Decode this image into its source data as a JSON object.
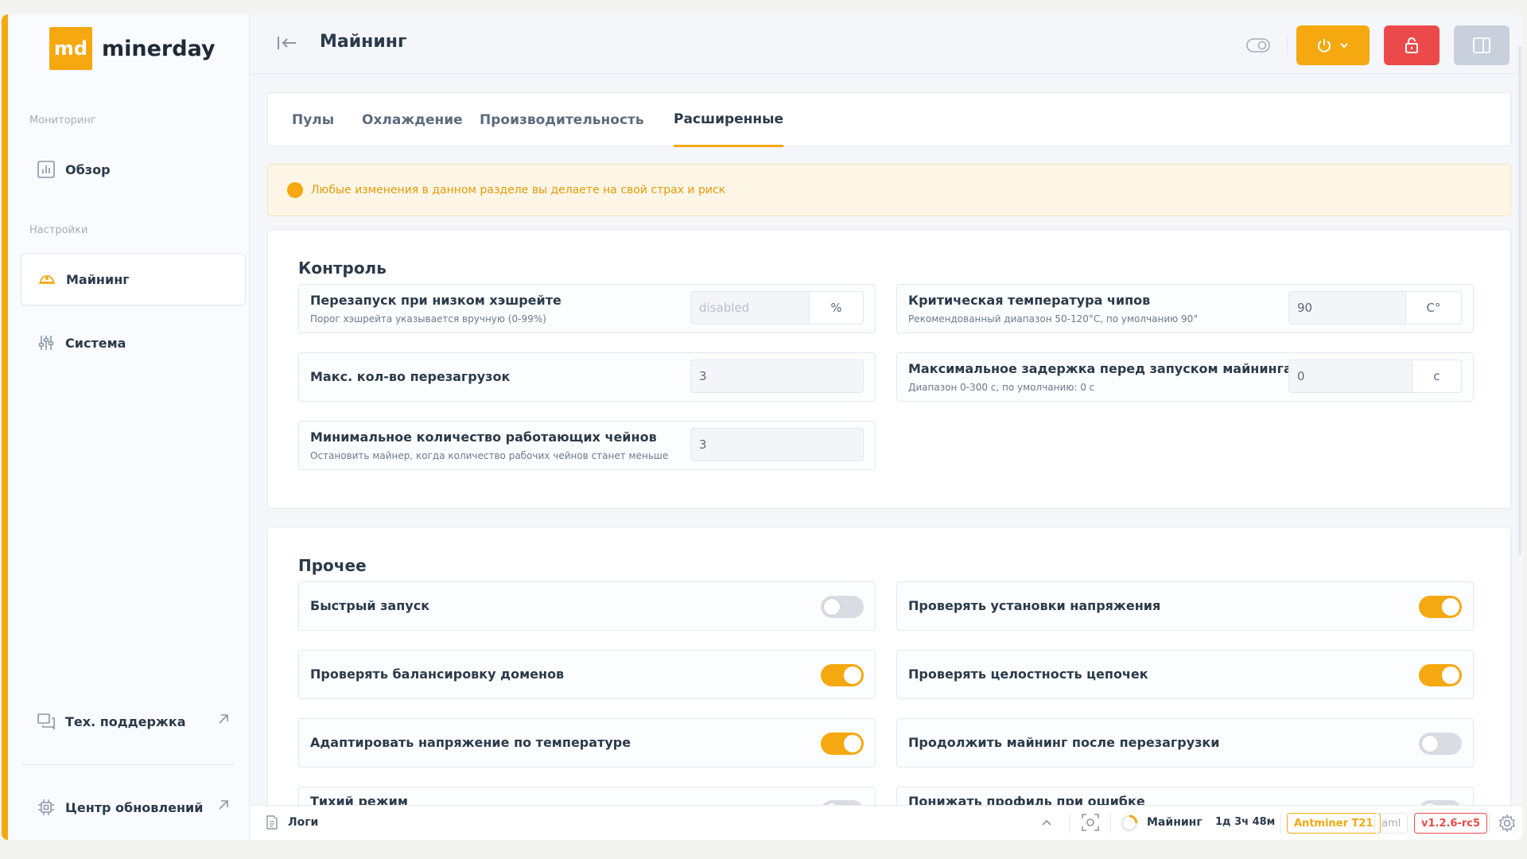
{
  "app": {
    "logo_mark": "md",
    "logo_name": "minerday"
  },
  "sidebar": {
    "section_monitoring": "Мониторинг",
    "overview": "Обзор",
    "section_settings": "Настройки",
    "mining": "Майнинг",
    "system": "Система",
    "support": "Тех. поддержка",
    "updates": "Центр обновлений"
  },
  "header": {
    "title": "Майнинг"
  },
  "tabs": [
    "Пулы",
    "Охлаждение",
    "Производительность",
    "Расширенные"
  ],
  "warning": "Любые изменения в данном разделе вы делаете на свой страх и риск",
  "control": {
    "title": "Контроль",
    "restart_low_hash": {
      "label": "Перезапуск при низком хэшрейте",
      "sub": "Порог хэшрейта указывается вручную (0-99%)",
      "placeholder": "disabled",
      "unit": "%"
    },
    "critical_temp": {
      "label": "Критическая температура чипов",
      "sub": "Рекомендованный диапазон 50-120°C, по умолчанию 90°",
      "value": "90",
      "unit": "C°"
    },
    "max_reboots": {
      "label": "Макс. кол-во перезагрузок",
      "value": "3"
    },
    "max_delay": {
      "label": "Максимальное задержка перед запуском майнинга",
      "sub": "Диапазон 0-300 с, по умолчанию: 0 с",
      "value": "0",
      "unit": "с"
    },
    "min_chains": {
      "label": "Минимальное количество работающих чейнов",
      "sub": "Остановить майнер, когда количество рабочих чейнов станет меньше",
      "value": "3"
    }
  },
  "other": {
    "title": "Прочее",
    "fast_start": {
      "label": "Быстрый запуск",
      "on": false
    },
    "check_voltage": {
      "label": "Проверять установки напряжения",
      "on": true
    },
    "check_balance": {
      "label": "Проверять балансировку доменов",
      "on": true
    },
    "check_chains": {
      "label": "Проверять целостность цепочек",
      "on": true
    },
    "adapt_voltage": {
      "label": "Адаптировать напряжение по температуре",
      "on": true
    },
    "continue_after_reboot": {
      "label": "Продолжить майнинг после перезагрузки",
      "on": false
    },
    "quiet_mode": {
      "label": "Тихий режим",
      "on": false
    },
    "lower_profile": {
      "label": "Понижать профиль при ошибке",
      "on": false
    }
  },
  "status": {
    "logs": "Логи",
    "state": "Майнинг",
    "uptime": "1д 3ч 48м",
    "model": "Antminer T21",
    "firmware": "aml",
    "version": "v1.2.6-rc5"
  },
  "colors": {
    "accent": "#f5a80f",
    "danger": "#ec4a4a"
  }
}
